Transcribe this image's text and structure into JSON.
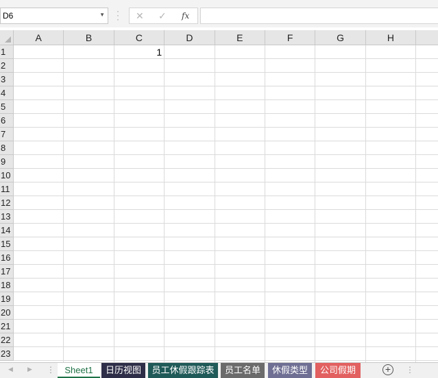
{
  "formula_bar": {
    "name_box": "D6",
    "fx_label": "fx",
    "formula": ""
  },
  "columns": [
    "A",
    "B",
    "C",
    "D",
    "E",
    "F",
    "G",
    "H"
  ],
  "rows": [
    "1",
    "2",
    "3",
    "4",
    "5",
    "6",
    "7",
    "8",
    "9",
    "10",
    "11",
    "12",
    "13",
    "14",
    "15",
    "16",
    "17",
    "18",
    "19",
    "20",
    "21",
    "22",
    "23"
  ],
  "cells": {
    "C1": "1"
  },
  "sheet_tabs": [
    {
      "label": "Sheet1",
      "color": "#ffffff",
      "active": true
    },
    {
      "label": "日历视图",
      "color": "#2e2e48",
      "active": false
    },
    {
      "label": "员工休假跟踪表",
      "color": "#1f5a58",
      "active": false
    },
    {
      "label": "员工名单",
      "color": "#6b6b6b",
      "active": false
    },
    {
      "label": "休假类型",
      "color": "#6f6f94",
      "active": false
    },
    {
      "label": "公司假期",
      "color": "#e26060",
      "active": false
    }
  ],
  "colors": {
    "grid_line": "#dadada",
    "header_bg": "#e6e6e6",
    "accent": "#1e7145"
  }
}
